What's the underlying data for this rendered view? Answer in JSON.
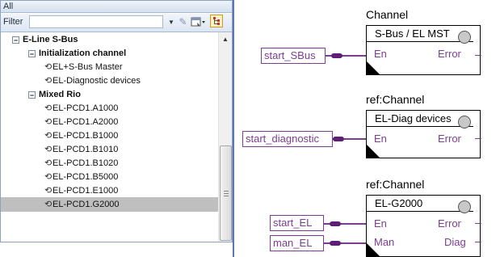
{
  "panel": {
    "header": "All",
    "filter": {
      "label": "Filter",
      "value": "",
      "dropdown_icon": "dropdown-arrow-icon",
      "clear_icon": "pencil-clear-icon",
      "properties_icon": "properties-icon",
      "hierarchy_icon": "hierarchy-icon"
    },
    "tree": [
      {
        "label": "E-Line S-Bus",
        "level": 0,
        "bold": true,
        "expander": "⊟"
      },
      {
        "label": "Initialization channel",
        "level": 1,
        "bold": true,
        "expander": "⊟"
      },
      {
        "label": "EL+S-Bus Master",
        "level": 2,
        "bold": false
      },
      {
        "label": "EL-Diagnostic devices",
        "level": 2,
        "bold": false
      },
      {
        "label": "Mixed Rio",
        "level": 1,
        "bold": true,
        "expander": "⊟"
      },
      {
        "label": "EL-PCD1.A1000",
        "level": 2,
        "bold": false
      },
      {
        "label": "EL-PCD1.A2000",
        "level": 2,
        "bold": false
      },
      {
        "label": "EL-PCD1.B1000",
        "level": 2,
        "bold": false
      },
      {
        "label": "EL-PCD1.B1010",
        "level": 2,
        "bold": false
      },
      {
        "label": "EL-PCD1.B1020",
        "level": 2,
        "bold": false
      },
      {
        "label": "EL-PCD1.B5000",
        "level": 2,
        "bold": false
      },
      {
        "label": "EL-PCD1.E1000",
        "level": 2,
        "bold": false
      },
      {
        "label": "EL-PCD1.G2000",
        "level": 2,
        "bold": false,
        "selected": true
      }
    ]
  },
  "diagram": {
    "blocks": [
      {
        "caption": "Channel",
        "name": "S-Bus / EL MST",
        "inputs": [
          {
            "port": "En",
            "signal": "start_SBus"
          }
        ],
        "outputs": [
          "Error"
        ]
      },
      {
        "caption": "ref:Channel",
        "name": "EL-Diag devices",
        "inputs": [
          {
            "port": "En",
            "signal": "start_diagnostic"
          }
        ],
        "outputs": [
          "Error"
        ]
      },
      {
        "caption": "ref:Channel",
        "name": "EL-G2000",
        "inputs": [
          {
            "port": "En",
            "signal": "start_EL"
          },
          {
            "port": "Man",
            "signal": "man_EL"
          }
        ],
        "outputs": [
          "Error",
          "Diag"
        ]
      }
    ],
    "colors": {
      "wire": "#7a3e8e",
      "wire_end": "#5d1f73",
      "led": "#c8c8c8",
      "selection": "#bfbfbf"
    }
  }
}
